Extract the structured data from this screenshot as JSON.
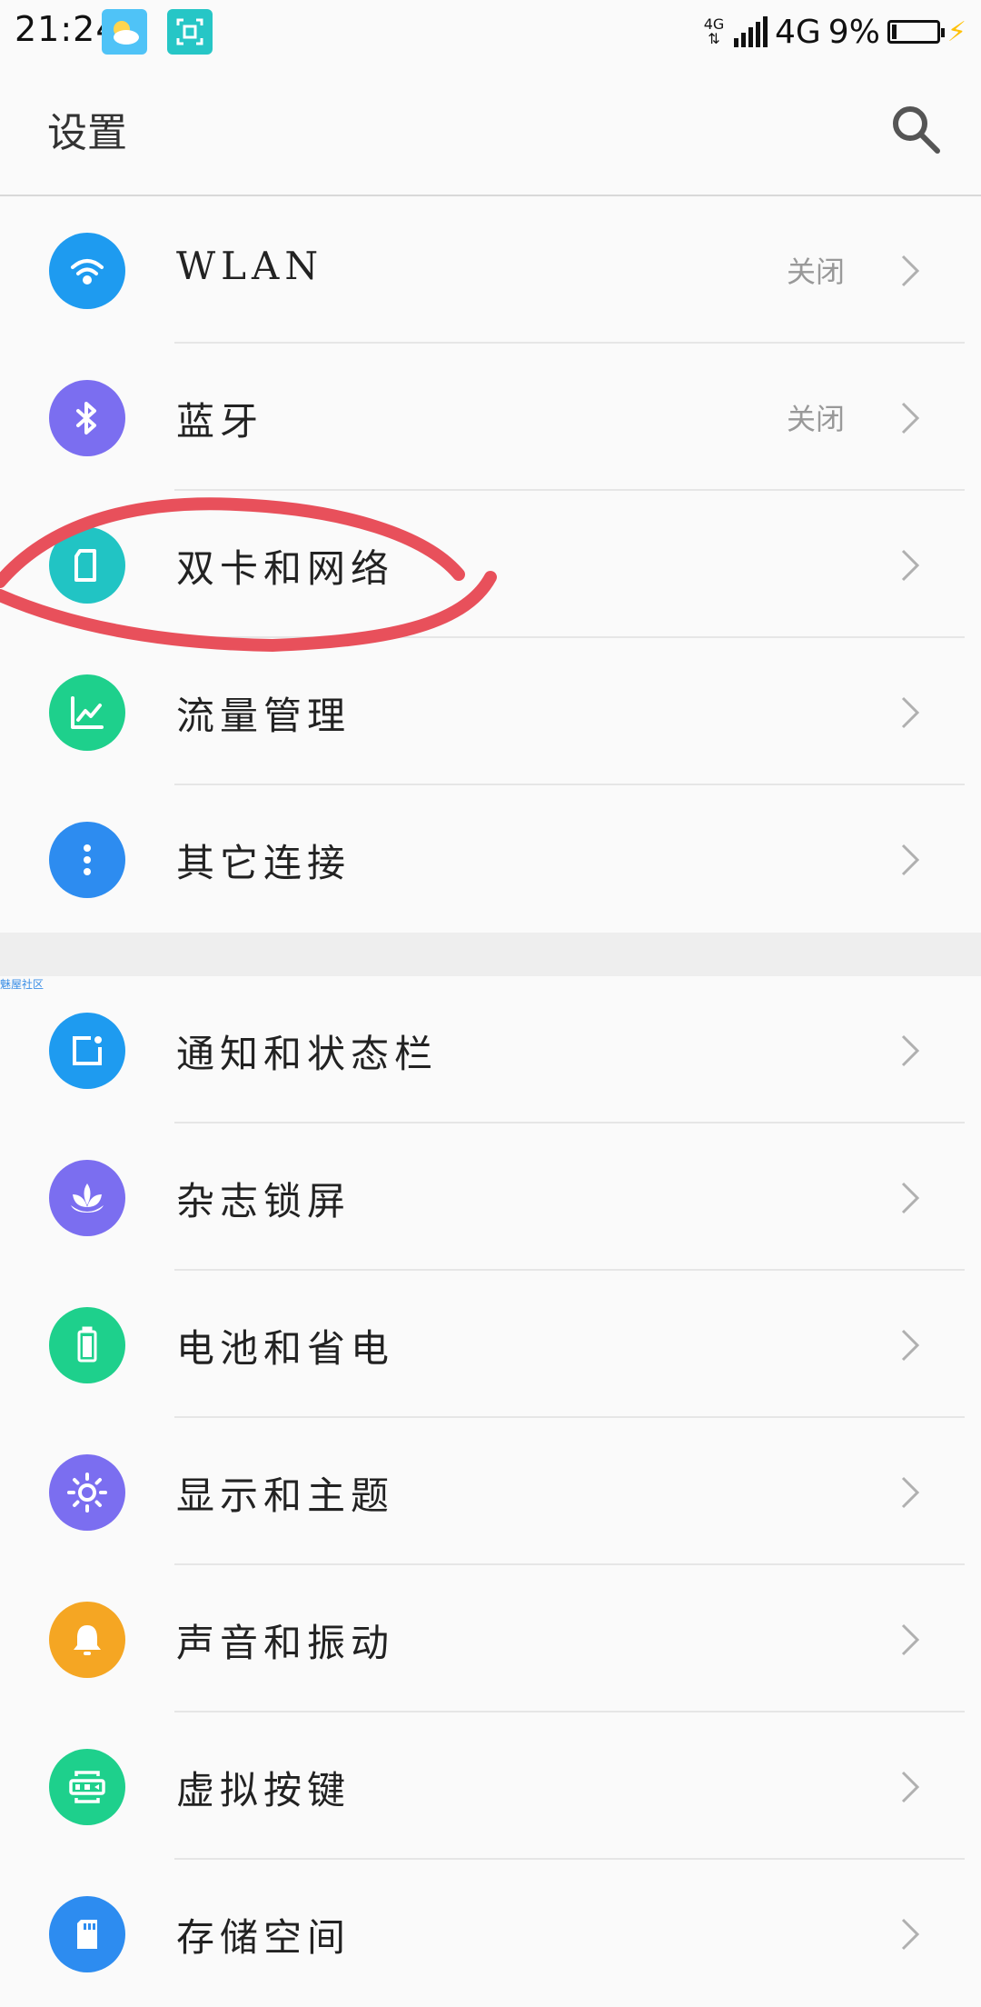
{
  "status_bar": {
    "time": "21:24",
    "network_small": "4G",
    "network": "4G",
    "battery": "9%",
    "battery_level": 0.09,
    "app_icons": [
      "weather-icon",
      "screenshot-scan-icon"
    ]
  },
  "header": {
    "title": "设置",
    "search_icon": "search-icon"
  },
  "section1": [
    {
      "label": "WLAN",
      "status": "关闭",
      "icon": "wifi-icon",
      "color": "#1e9bf0"
    },
    {
      "label": "蓝牙",
      "status": "关闭",
      "icon": "bluetooth-icon",
      "color": "#7b6ef0"
    },
    {
      "label": "双卡和网络",
      "status": "",
      "icon": "sim-card-icon",
      "color": "#21c4c4"
    },
    {
      "label": "流量管理",
      "status": "",
      "icon": "chart-trend-icon",
      "color": "#1ed08c"
    },
    {
      "label": "其它连接",
      "status": "",
      "icon": "more-dots-icon",
      "color": "#2d8cf0"
    }
  ],
  "watermark": "魅屋社区",
  "section2": [
    {
      "label": "通知和状态栏",
      "icon": "notification-icon",
      "color": "#1e9bf0"
    },
    {
      "label": "杂志锁屏",
      "icon": "lotus-icon",
      "color": "#7b6ef0"
    },
    {
      "label": "电池和省电",
      "icon": "battery-icon",
      "color": "#1ed08c"
    },
    {
      "label": "显示和主题",
      "icon": "brightness-icon",
      "color": "#7b6ef0"
    },
    {
      "label": "声音和振动",
      "icon": "bell-icon",
      "color": "#f5a623"
    },
    {
      "label": "虚拟按键",
      "icon": "virtual-keys-icon",
      "color": "#1ed08c"
    },
    {
      "label": "存储空间",
      "icon": "sd-card-icon",
      "color": "#2d8cf0"
    }
  ],
  "annotation_color": "#e8505b"
}
